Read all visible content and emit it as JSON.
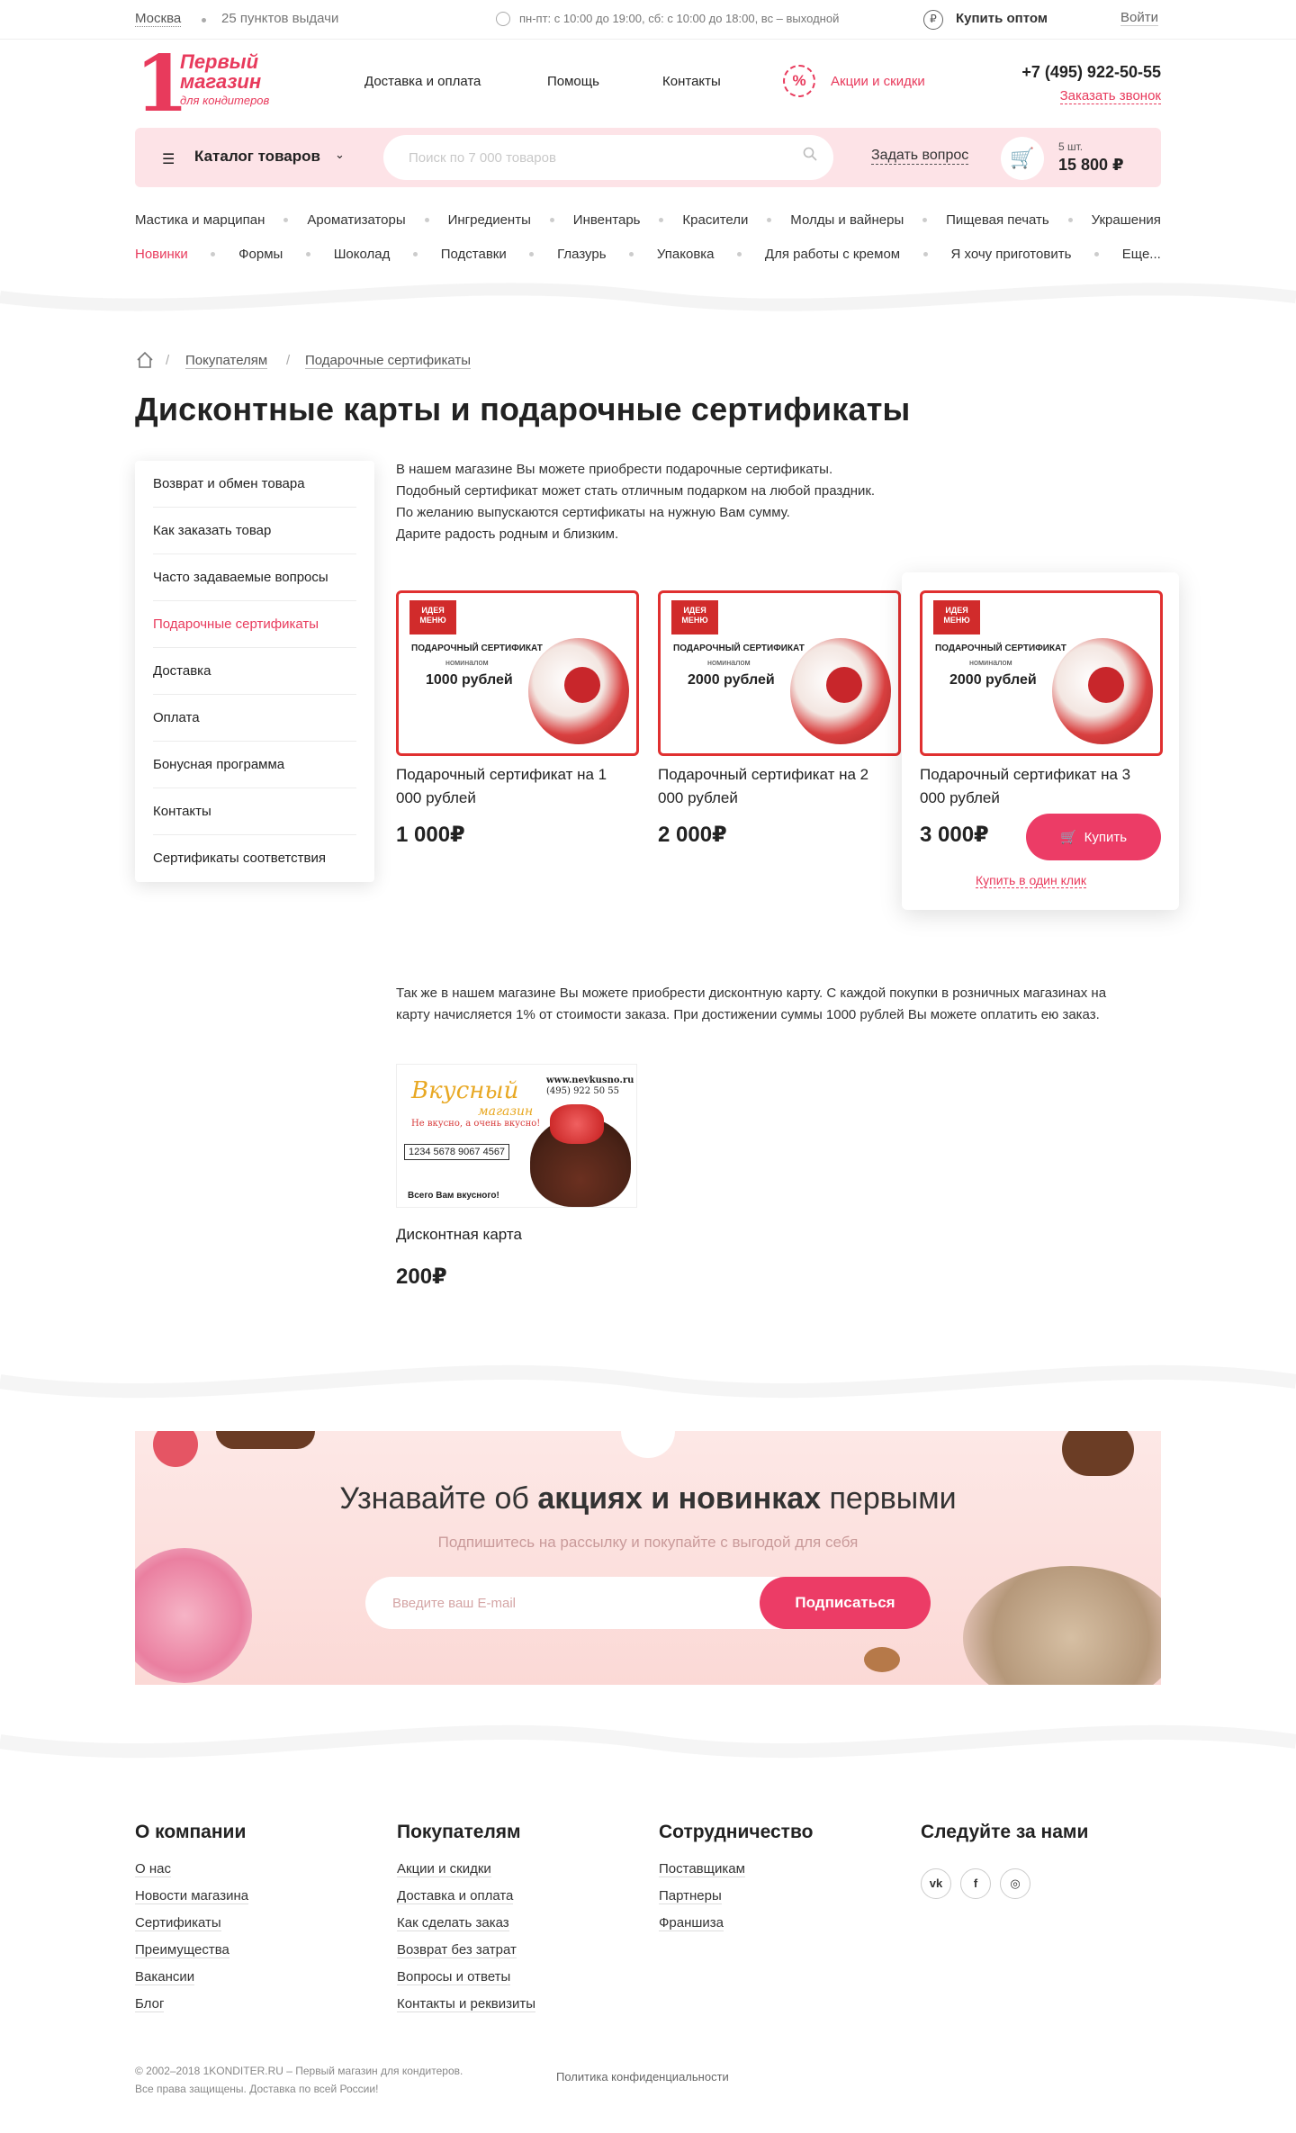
{
  "topbar": {
    "city": "Москва",
    "points": "25 пунктов выдачи",
    "hours": "пн-пт: с 10:00 до 19:00, сб: с 10:00 до 18:00, вс – выходной",
    "wholesale": "Купить оптом",
    "login": "Войти"
  },
  "logo": {
    "num": "1",
    "line1": "Первый",
    "line2": "магазин",
    "line3": "для кондитеров"
  },
  "nav": [
    "Доставка и оплата",
    "Помощь",
    "Контакты"
  ],
  "promo": "Акции и скидки",
  "phone": "+7 (495) 922-50-55",
  "callback": "Заказать звонок",
  "searchbar": {
    "catalog": "Каталог товаров",
    "placeholder": "Поиск по 7 000 товаров",
    "ask": "Задать вопрос",
    "cart_qty": "5 шт.",
    "cart_sum": "15 800 ₽"
  },
  "categories_row1": [
    "Мастика и марципан",
    "Ароматизаторы",
    "Ингредиенты",
    "Инвентарь",
    "Красители",
    "Молды и вайнеры",
    "Пищевая печать",
    "Украшения"
  ],
  "categories_row2": [
    "Новинки",
    "Формы",
    "Шоколад",
    "Подставки",
    "Глазурь",
    "Упаковка",
    "Для работы с кремом",
    "Я хочу приготовить",
    "Еще..."
  ],
  "breadcrumb": [
    "Покупателям",
    "Подарочные сертификаты"
  ],
  "title": "Дисконтные карты и подарочные сертификаты",
  "sidebar": [
    "Возврат и обмен товара",
    "Как заказать товар",
    "Часто задаваемые вопросы",
    "Подарочные сертификаты",
    "Доставка",
    "Оплата",
    "Бонусная программа",
    "Контакты",
    "Сертификаты соответствия"
  ],
  "intro": [
    "В нашем магазине Вы можете приобрести подарочные сертификаты.",
    "Подобный сертификат может стать отличным подарком на любой праздник.",
    "По желанию выпускаются сертификаты на нужную Вам сумму.",
    "Дарите радость родным и близким."
  ],
  "cert_image": {
    "logo": "ИДЕЯ МЕНЮ",
    "heading": "ПОДАРОЧНЫЙ СЕРТИФИКАТ",
    "nominal": "номиналом"
  },
  "products": [
    {
      "image_value": "1000 рублей",
      "title": "Подарочный сертификат на 1 000 рублей",
      "price": "1 000₽"
    },
    {
      "image_value": "2000 рублей",
      "title": "Подарочный сертификат на 2 000 рублей",
      "price": "2 000₽"
    },
    {
      "image_value": "2000 рублей",
      "title": "Подарочный сертификат на 3 000 рублей",
      "price": "3 000₽"
    }
  ],
  "buy_label": "Купить",
  "one_click": "Купить в один клик",
  "discount_text": "Так же в нашем магазине Вы можете приобрести дисконтную карту. С каждой покупки в розничных магазинах на карту начисляется 1% от стоимости заказа. При достижении суммы 1000 рублей Вы можете оплатить ею заказ.",
  "discount_card": {
    "brand": "Вкусный",
    "brand2": "магазин",
    "slogan": "Не вкусно, а очень вкусно!",
    "number": "1234 5678 9067 4567",
    "bye": "Всего Вам вкусного!",
    "site": "www.nevkusno.ru",
    "phone": "(495) 922 50 55",
    "title": "Дисконтная карта",
    "price": "200₽"
  },
  "newsletter": {
    "pre": "Узнавайте об ",
    "bold": "акциях и новинках",
    "post": " первыми",
    "sub": "Подпишитесь на рассылку и покупайте с выгодой для себя",
    "placeholder": "Введите ваш E-mail",
    "button": "Подписаться"
  },
  "footer": {
    "col1": {
      "title": "О компании",
      "links": [
        "О нас",
        "Новости магазина",
        "Сертификаты",
        "Преимущества",
        "Вакансии",
        "Блог"
      ]
    },
    "col2": {
      "title": "Покупателям",
      "links": [
        "Акции и скидки",
        "Доставка и оплата",
        "Как сделать заказ",
        "Возврат без затрат",
        "Вопросы и ответы",
        "Контакты и реквизиты"
      ]
    },
    "col3": {
      "title": "Сотрудничество",
      "links": [
        "Поставщикам",
        "Партнеры",
        "Франшиза"
      ]
    },
    "col4": {
      "title": "Следуйте за нами",
      "social": [
        "vk",
        "f",
        "ig"
      ]
    },
    "copy1": "© 2002–2018 1KONDITER.RU – Первый магазин для кондитеров.",
    "copy2": "Все права защищены. Доставка по всей России!",
    "policy": "Политика конфиденциальности"
  },
  "colors": {
    "accent": "#ec3c66",
    "pink_bg": "#fde3e7"
  }
}
